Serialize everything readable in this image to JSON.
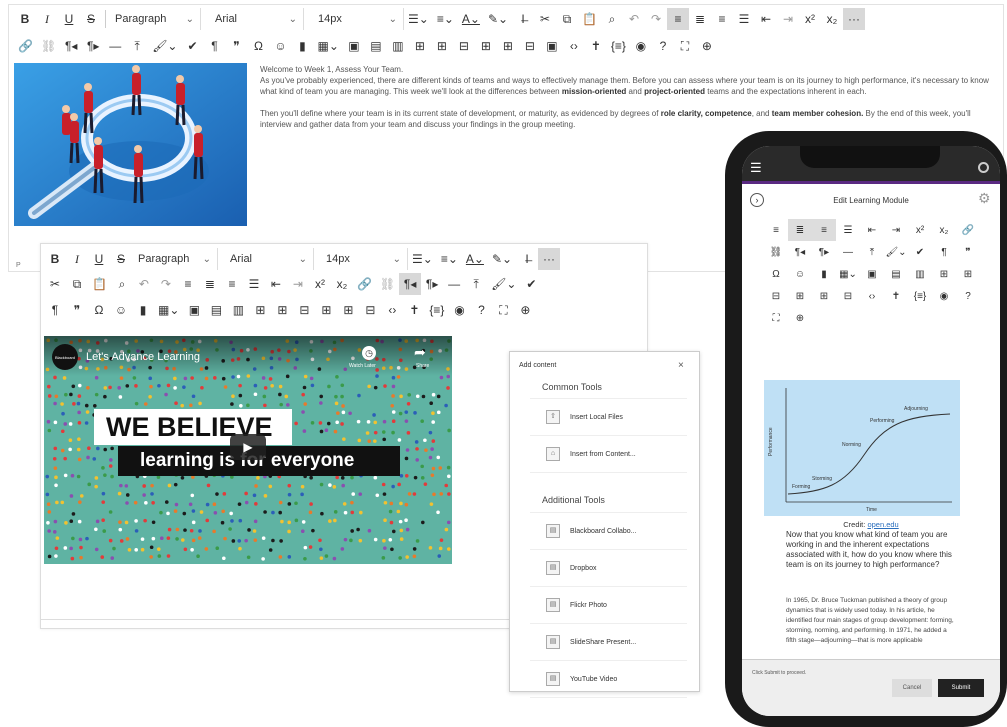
{
  "top_toolbar": {
    "row1": {
      "bold": "B",
      "italic": "I",
      "underline": "U",
      "strike": "S",
      "format": "Paragraph",
      "font": "Arial",
      "size": "14px",
      "more": "···"
    },
    "row2_icons": [
      "link-icon",
      "unlink-icon",
      "rtl-icon",
      "ltr-icon",
      "hr-icon",
      "upload-icon",
      "format-icon",
      "check-icon",
      "pilcrow-icon",
      "quote-icon",
      "omega-icon",
      "emoji-icon",
      "bookmark-icon",
      "table-icon",
      "media-icon",
      "table-icons",
      "code-icon",
      "accessibility-icon",
      "braces-icon",
      "preview-icon",
      "help-icon",
      "fullscreen-icon",
      "add-icon"
    ]
  },
  "editor_top": {
    "heading": "Welcome to Week 1, Assess Your Team.",
    "para1_a": "As you've probably experienced, there are different kinds of teams and ways to effectively manage them. Before you can assess where your team is on its journey to high performance, it's necessary to know what kind of team you are managing. This week we'll look at the differences between ",
    "para1_b1": "mission-oriented",
    "para1_mid": " and ",
    "para1_b2": "project-oriented",
    "para1_c": " teams and the expectations inherent in each.",
    "para2_a": "Then you'll define where your team is in its current state of development, or maturity, as evidenced by degrees of ",
    "para2_b1": "role clarity, competence",
    "para2_mid": ", and ",
    "para2_b2": "team member cohesion.",
    "para2_c": " By the end of this week, you'll interview and gather data from your team and discuss your findings in the group meeting.",
    "path": "P"
  },
  "second_toolbar": {
    "format": "Paragraph",
    "font": "Arial",
    "size": "14px",
    "more": "···"
  },
  "video": {
    "channel": "Blackboard",
    "title": "Let's Advance Learning",
    "watch_later": "Watch Later",
    "share": "Share",
    "headline1": "WE BELIEVE",
    "headline2": "learning is for everyone"
  },
  "add_content": {
    "title": "Add content",
    "close": "×",
    "common_heading": "Common Tools",
    "common": [
      "Insert Local Files",
      "Insert from Content..."
    ],
    "additional_heading": "Additional Tools",
    "additional": [
      "Blackboard Collabo...",
      "Dropbox",
      "Flickr Photo",
      "SlideShare Present...",
      "YouTube Video"
    ]
  },
  "phone": {
    "title": "Edit Learning Module",
    "graph": {
      "ylabel": "Performance",
      "xlabel": "Time",
      "stages": [
        "Forming",
        "Storming",
        "Norming",
        "Performing",
        "Adjourning"
      ]
    },
    "credit_label": "Credit:",
    "credit_link": "open.edu",
    "body1": "Now that you know what kind of team you are working in and the inherent expectations associated with it, how do you know where this team is on its journey to high performance?",
    "body2": "In 1965, Dr. Bruce Tuckman published a theory of group dynamics that is widely used today. In his article, he identified four main stages of group development: forming, storming, norming, and performing. In 1971, he added a fifth stage—adjourning—that is more applicable",
    "footer_hint": "Click Submit to proceed.",
    "cancel": "Cancel",
    "submit": "Submit"
  },
  "colors": {
    "accent_purple": "#5a2a82",
    "teal": "#5fb3a3",
    "blue_image": "#2f8fd8"
  }
}
